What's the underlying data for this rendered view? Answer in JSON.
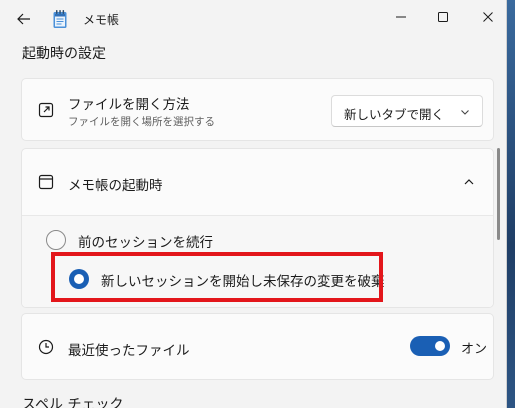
{
  "window": {
    "title": "メモ帳"
  },
  "header": {
    "section_title": "起動時の設定"
  },
  "open_file": {
    "label": "ファイルを開く方法",
    "description": "ファイルを開く場所を選択する",
    "dropdown_value": "新しいタブで開く"
  },
  "startup": {
    "label": "メモ帳の起動時",
    "options": [
      {
        "label": "前のセッションを続行",
        "selected": false
      },
      {
        "label": "新しいセッションを開始し未保存の変更を破棄",
        "selected": true
      }
    ]
  },
  "recent_files": {
    "label": "最近使ったファイル",
    "toggle_label": "オン",
    "toggle_on": true
  },
  "next_section": {
    "title": "スペル チェック"
  },
  "colors": {
    "accent": "#1a5fb4",
    "highlight": "#e3161b",
    "background": "#f3f3f3"
  },
  "icons": [
    "back-arrow-icon",
    "notepad-icon",
    "minimize-icon",
    "maximize-icon",
    "close-icon",
    "open-external-icon",
    "chevron-down-icon",
    "window-icon",
    "chevron-up-icon",
    "clock-icon"
  ]
}
